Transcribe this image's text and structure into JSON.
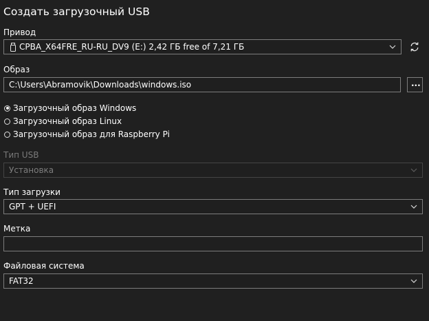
{
  "window": {
    "title": "Создать загрузочный USB"
  },
  "drive": {
    "label": "Привод",
    "selected": "CPBA_X64FRE_RU-RU_DV9 (E:) 2,42 ГБ free of 7,21 ГБ",
    "icon": "usb-drive-icon",
    "refresh_icon": "refresh-icon"
  },
  "image": {
    "label": "Образ",
    "path": "C:\\Users\\Abramovik\\Downloads\\windows.iso",
    "browse_label": "..."
  },
  "image_type": {
    "options": [
      {
        "label": "Загрузочный образ Windows",
        "checked": true
      },
      {
        "label": "Загрузочный образ Linux",
        "checked": false
      },
      {
        "label": "Загрузочный образ для Raspberry Pi",
        "checked": false
      }
    ]
  },
  "usb_type": {
    "label": "Тип USB",
    "selected": "Установка",
    "disabled": true
  },
  "boot_type": {
    "label": "Тип загрузки",
    "selected": "GPT + UEFI"
  },
  "volume_label": {
    "label": "Метка",
    "value": ""
  },
  "file_system": {
    "label": "Файловая система",
    "selected": "FAT32"
  },
  "colors": {
    "background": "#202020",
    "border": "#7d7d7d",
    "disabled_border": "#454545",
    "disabled_text": "#7d7d7d",
    "text": "#ffffff"
  }
}
